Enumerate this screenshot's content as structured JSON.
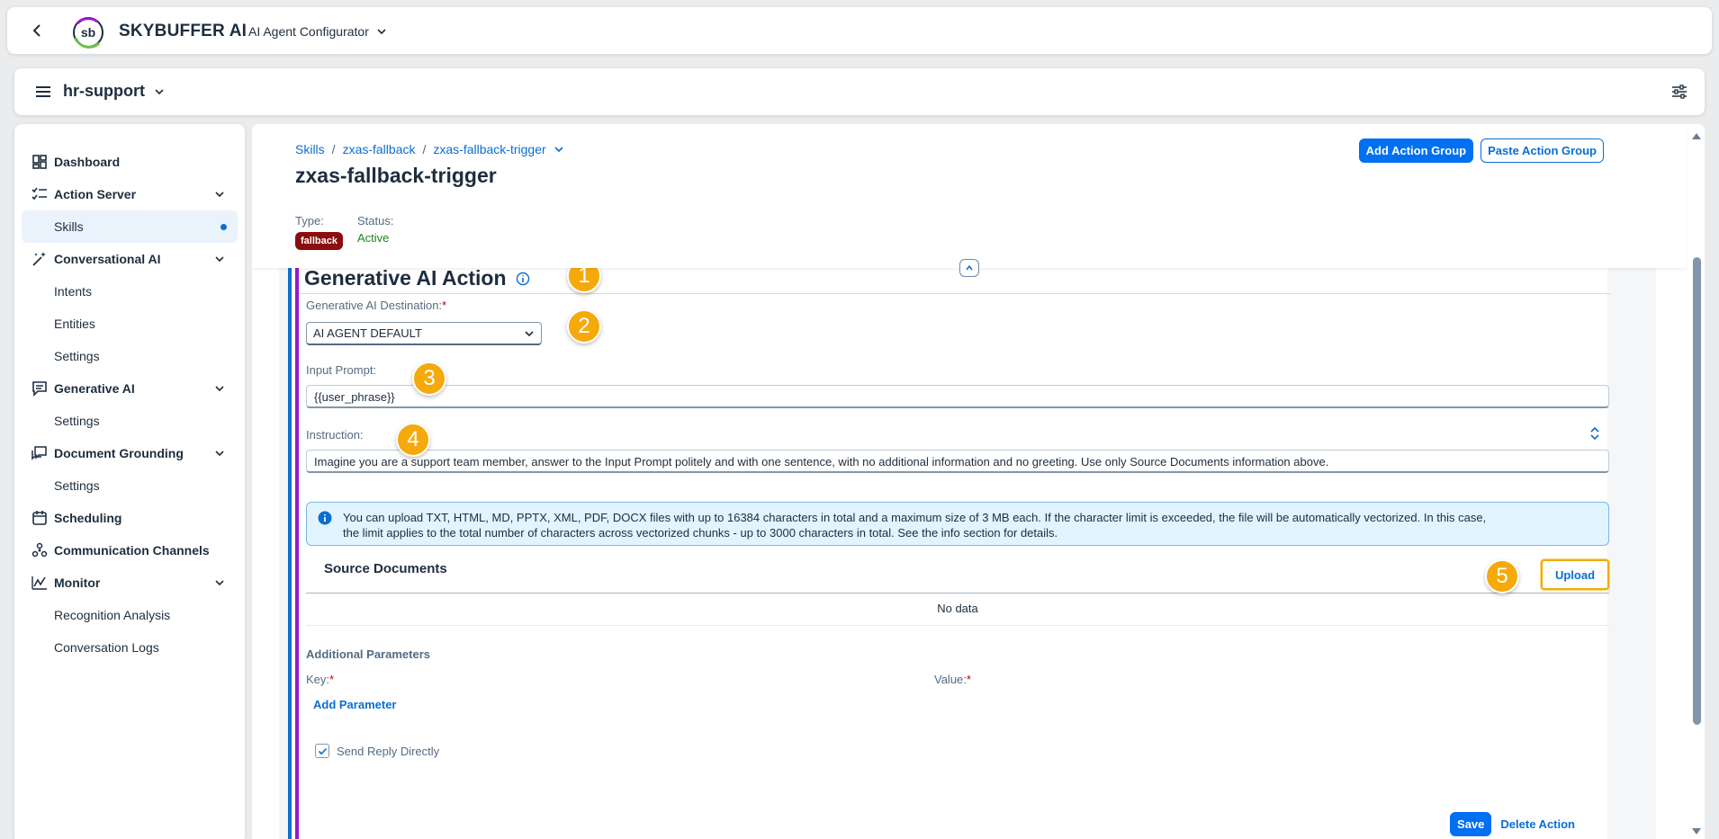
{
  "shell": {
    "brand": "SKYBUFFER AI",
    "app_selector": "AI Agent Configurator"
  },
  "topbar": {
    "project": "hr-support"
  },
  "sidebar": {
    "items": [
      {
        "label": "Dashboard",
        "icon": "dashboard-icon"
      },
      {
        "label": "Action Server",
        "icon": "checklist-icon"
      },
      {
        "label": "Skills"
      },
      {
        "label": "Conversational AI",
        "icon": "magic-wand-icon"
      },
      {
        "label": "Intents"
      },
      {
        "label": "Entities"
      },
      {
        "label": "Settings"
      },
      {
        "label": "Generative AI",
        "icon": "chat-icon"
      },
      {
        "label": "Settings"
      },
      {
        "label": "Document Grounding",
        "icon": "document-chat-icon"
      },
      {
        "label": "Settings"
      },
      {
        "label": "Scheduling",
        "icon": "calendar-icon"
      },
      {
        "label": "Communication Channels",
        "icon": "network-icon"
      },
      {
        "label": "Monitor",
        "icon": "line-chart-icon"
      },
      {
        "label": "Recognition Analysis"
      },
      {
        "label": "Conversation Logs"
      }
    ]
  },
  "breadcrumb": {
    "items": [
      "Skills",
      "zxas-fallback",
      "zxas-fallback-trigger"
    ],
    "separator": "/"
  },
  "page": {
    "title": "zxas-fallback-trigger",
    "type_label": "Type:",
    "type_value": "fallback",
    "status_label": "Status:",
    "status_value": "Active",
    "add_action_group": "Add Action Group",
    "paste_action_group": "Paste Action Group"
  },
  "action": {
    "title": "Generative AI Action",
    "destination_label": "Generative AI Destination:",
    "destination_value": "AI AGENT DEFAULT",
    "input_prompt_label": "Input Prompt:",
    "input_prompt_value": "{{user_phrase}}",
    "instruction_label": "Instruction:",
    "instruction_value": "Imagine you are a support team member, answer to the Input Prompt politely and with one sentence, with no additional information and no greeting. Use only Source Documents information above.",
    "info_line1": "You can upload TXT, HTML, MD, PPTX, XML, PDF, DOCX files with up to 16384 characters in total and a maximum size of 3 MB each. If the character limit is exceeded, the file will be automatically vectorized. In this case,",
    "info_line2": "the limit applies to the total number of characters across vectorized chunks - up to 3000 characters in total. See the info section for details.",
    "source_docs_title": "Source Documents",
    "upload_label": "Upload",
    "no_data": "No data",
    "additional_params": "Additional Parameters",
    "key_label": "Key:",
    "value_label": "Value:",
    "add_parameter": "Add Parameter",
    "send_reply": "Send Reply Directly",
    "send_reply_checked": true,
    "save": "Save",
    "delete": "Delete Action"
  },
  "markers": [
    "1",
    "2",
    "3",
    "4",
    "5"
  ],
  "colors": {
    "accent": "#0a6ed1",
    "marker": "#f5a90b",
    "fallback_badge": "#8b0d0d",
    "status_active": "#188918",
    "action_border": "#9b18c9"
  }
}
